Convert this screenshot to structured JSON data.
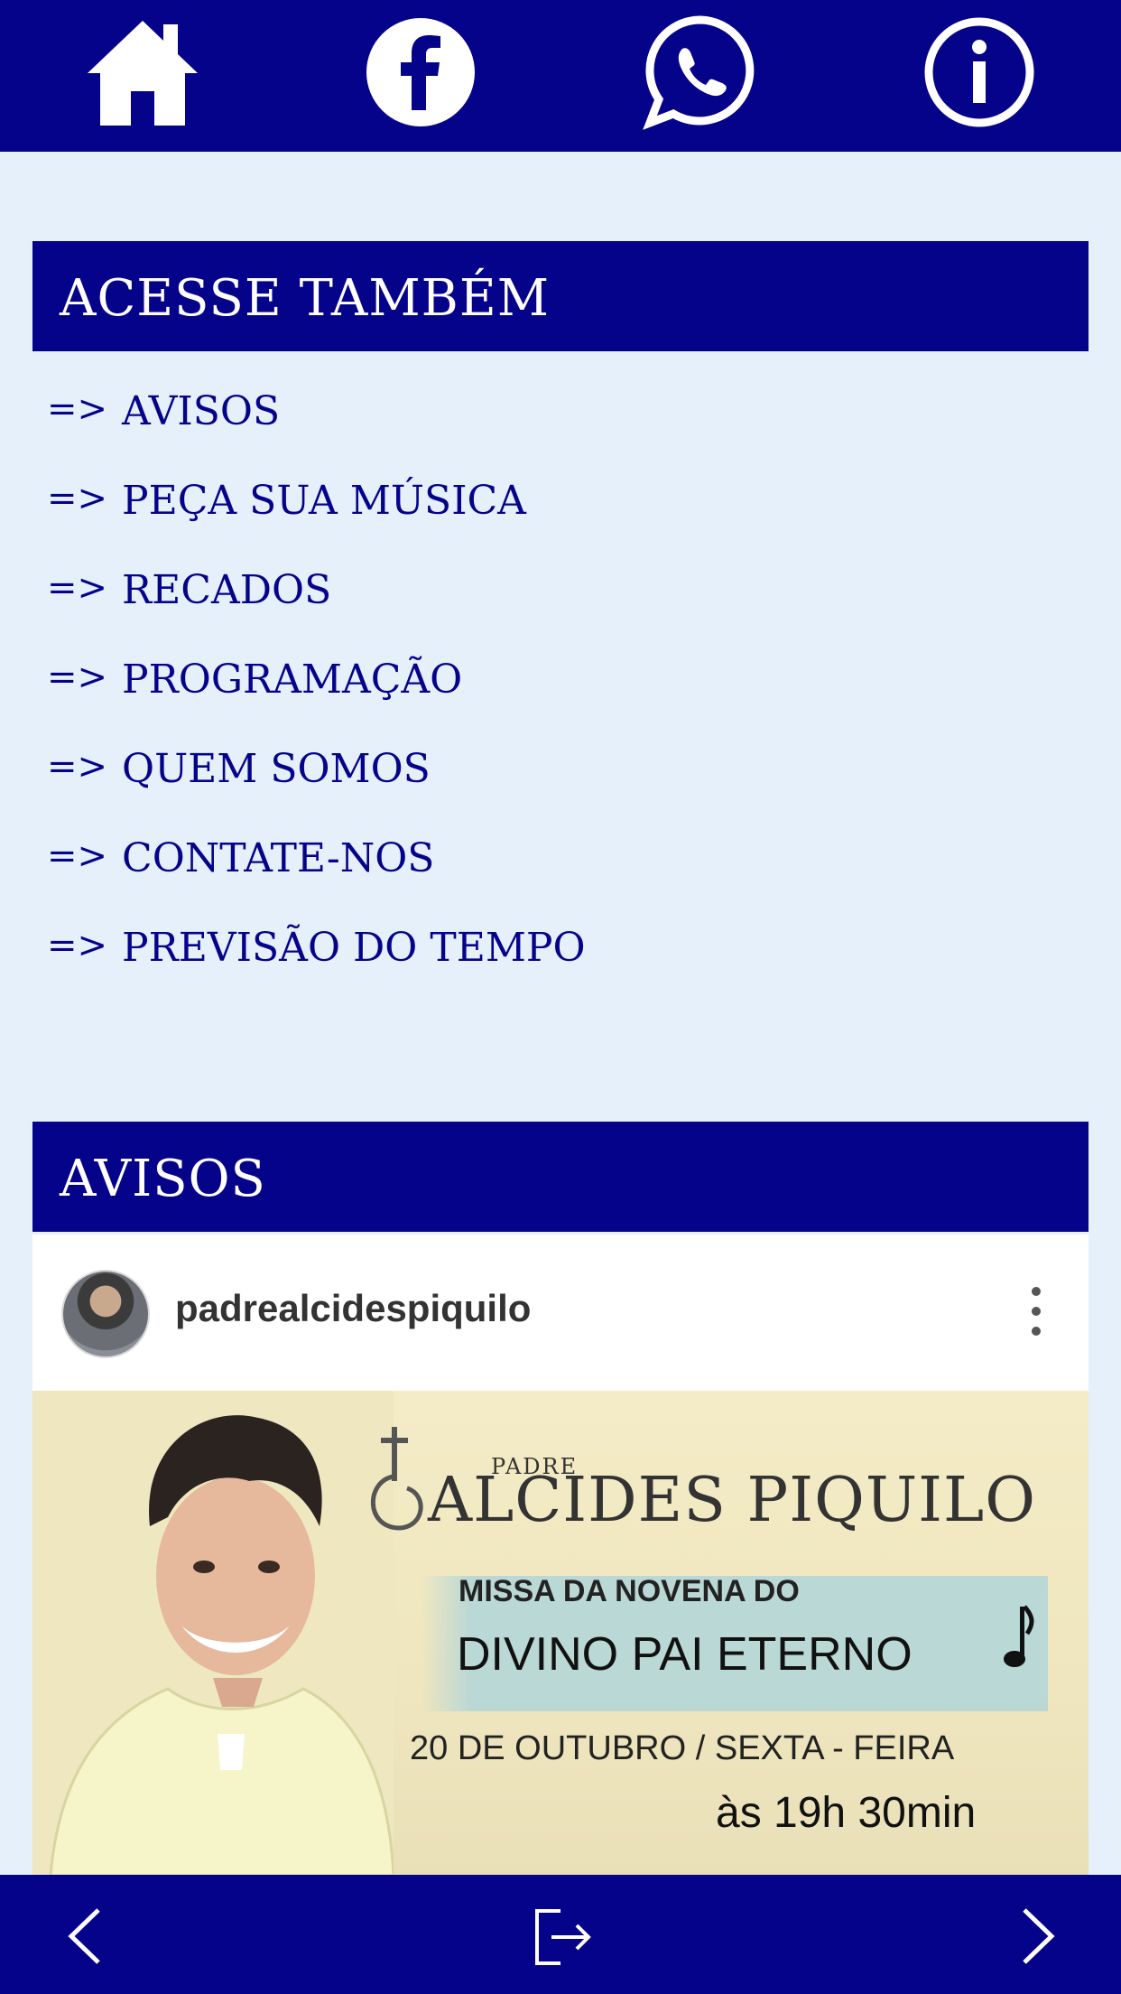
{
  "top_nav": {
    "icons": [
      "home-icon",
      "facebook-icon",
      "whatsapp-icon",
      "info-icon"
    ]
  },
  "access_section": {
    "title": "ACESSE TAMBÉM",
    "arrow": "=>",
    "links": [
      "AVISOS",
      "PEÇA SUA MÚSICA",
      "RECADOS",
      "PROGRAMAÇÃO",
      "QUEM SOMOS",
      "CONTATE-NOS",
      "PREVISÃO DO TEMPO"
    ]
  },
  "notices_section": {
    "title": "AVISOS",
    "post": {
      "username": "padrealcidespiquilo",
      "poster": {
        "padre": "PADRE",
        "name": "ALCIDES PIQUILO",
        "line1": "MISSA DA NOVENA DO",
        "line2": "DIVINO PAI ETERNO",
        "date": "20 DE OUTUBRO / SEXTA - FEIRA",
        "time": "às 19h 30min"
      }
    }
  },
  "bottom_nav": {
    "icons": [
      "back-arrow-icon",
      "share-exit-icon",
      "forward-arrow-icon"
    ]
  },
  "colors": {
    "bar": "#06038b",
    "background": "#e6f0fb",
    "link_text": "#06038b"
  }
}
